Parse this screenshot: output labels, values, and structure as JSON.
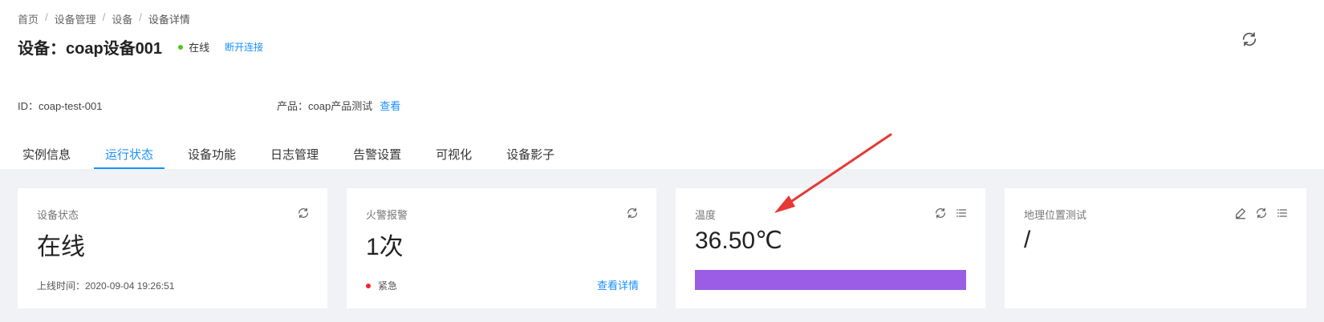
{
  "breadcrumb": {
    "items": [
      "首页",
      "设备管理",
      "设备",
      "设备详情"
    ],
    "separator": "/"
  },
  "device": {
    "title": "设备：coap设备001",
    "status": "在线",
    "status_color": "#52c41a",
    "disconnect_label": "断开连接",
    "id_line": "ID：coap-test-001",
    "product_prefix": "产品：coap产品测试",
    "product_view_label": "查看"
  },
  "icons": {
    "top_refresh": "refresh-icon",
    "card_refresh": "refresh-icon",
    "card_list": "list-icon",
    "card_edit": "edit-icon"
  },
  "tabs": [
    {
      "label": "实例信息",
      "active": false
    },
    {
      "label": "运行状态",
      "active": true
    },
    {
      "label": "设备功能",
      "active": false
    },
    {
      "label": "日志管理",
      "active": false
    },
    {
      "label": "告警设置",
      "active": false
    },
    {
      "label": "可视化",
      "active": false
    },
    {
      "label": "设备影子",
      "active": false
    }
  ],
  "cards": {
    "device_status": {
      "label": "设备状态",
      "value": "在线",
      "footer": "上线时间：2020-09-04 19:26:51"
    },
    "fire_alarm": {
      "label": "火警报警",
      "value": "1次",
      "level": "紧急",
      "level_color": "#f5222d",
      "detail_label": "查看详情"
    },
    "temperature": {
      "label": "温度",
      "value": "36.50℃",
      "bar_fill_fraction": 1.0,
      "bar_color": "#9b5de5"
    },
    "geo_test": {
      "label": "地理位置测试",
      "value": "/"
    }
  },
  "colors": {
    "accent": "#1890ff",
    "arrow": "#e53935",
    "content_background": "#f0f2f5"
  }
}
